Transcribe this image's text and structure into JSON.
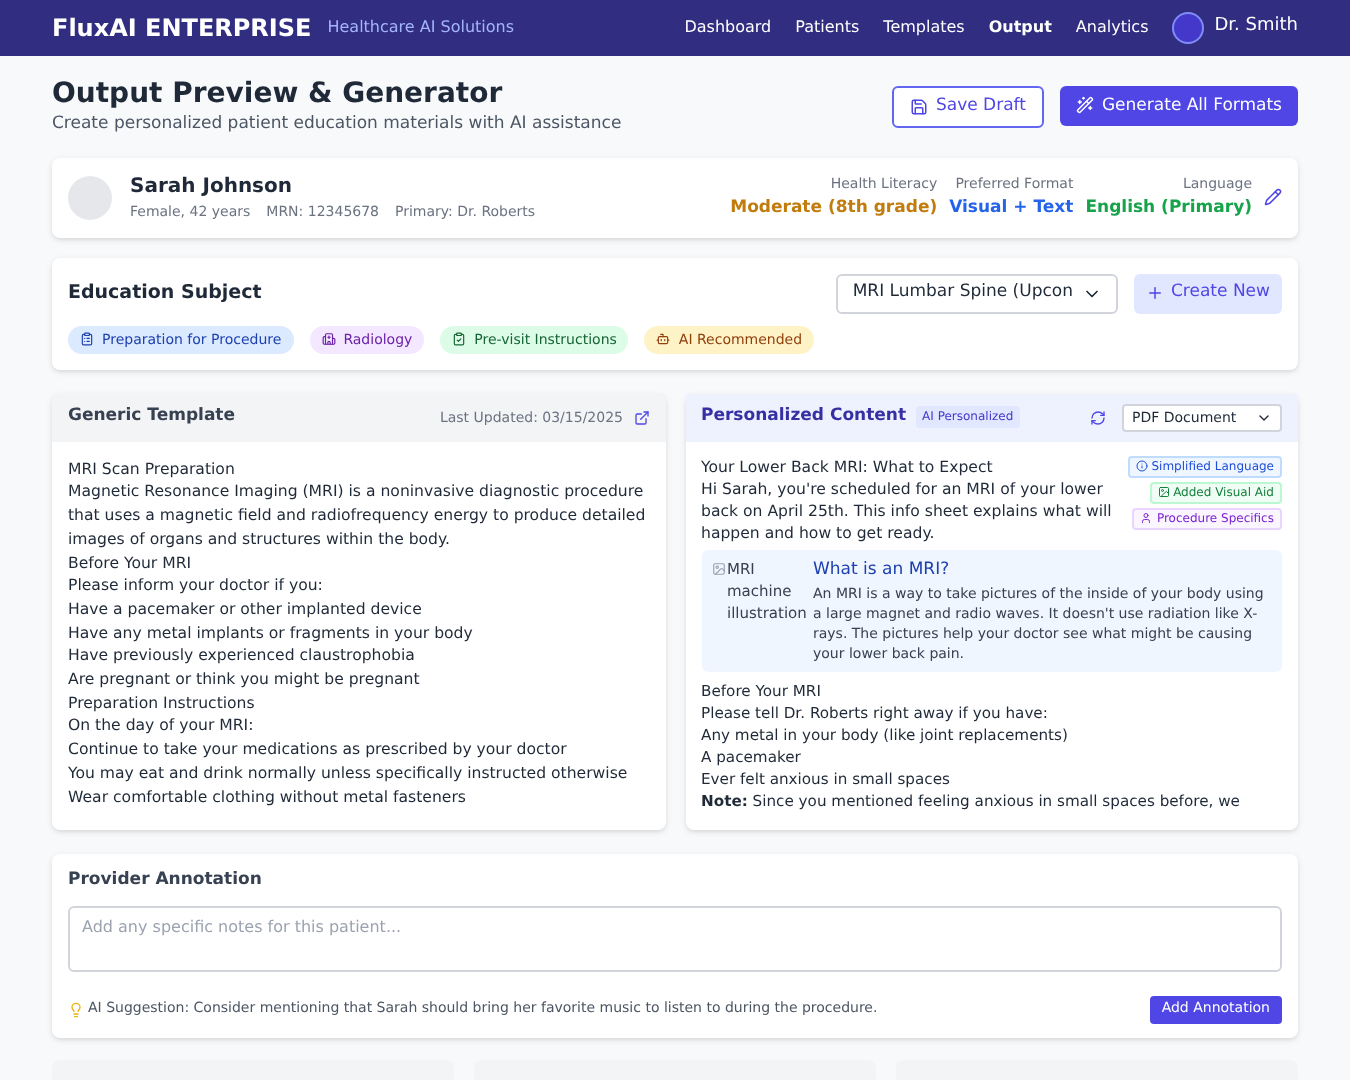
{
  "nav": {
    "brand": "FluxAI ENTERPRISE",
    "tagline": "Healthcare AI Solutions",
    "items": [
      {
        "label": "Dashboard",
        "selected": false
      },
      {
        "label": "Patients",
        "selected": false
      },
      {
        "label": "Templates",
        "selected": false
      },
      {
        "label": "Output",
        "selected": true
      },
      {
        "label": "Analytics",
        "selected": false
      }
    ],
    "user": "Dr. Smith"
  },
  "header": {
    "title": "Output Preview & Generator",
    "subtitle": "Create personalized patient education materials with AI assistance",
    "save_button": "Save Draft",
    "generate_button": "Generate All Formats"
  },
  "patient": {
    "name": "Sarah Johnson",
    "details": [
      "Female, 42 years",
      "MRN: 12345678",
      "Primary: Dr. Roberts"
    ],
    "attributes": [
      {
        "label": "Health Literacy",
        "value": "Moderate (8th grade)",
        "kind": "literacy"
      },
      {
        "label": "Preferred Format",
        "value": "Visual + Text",
        "kind": "format"
      },
      {
        "label": "Language",
        "value": "English (Primary)",
        "kind": "language"
      }
    ]
  },
  "education": {
    "title": "Education Subject",
    "subject": "MRI Lumbar Spine (Upcon",
    "create_button": "Create New",
    "tags": [
      {
        "label": "Preparation for Procedure",
        "kind": "procedure"
      },
      {
        "label": "Radiology",
        "kind": "department"
      },
      {
        "label": "Pre-visit Instructions",
        "kind": "instructions"
      },
      {
        "label": "AI Recommended",
        "kind": "ai"
      }
    ]
  },
  "template": {
    "title": "Generic Template",
    "updated": "Last Updated: 03/15/2025",
    "lines": [
      "MRI Scan Preparation",
      "Magnetic Resonance Imaging (MRI) is a noninvasive diagnostic procedure that uses a magnetic field and radiofrequency energy to produce detailed images of organs and structures within the body.",
      "Before Your MRI",
      "Please inform your doctor if you:",
      "Have a pacemaker or other implanted device",
      "Have any metal implants or fragments in your body",
      "Have previously experienced claustrophobia",
      "Are pregnant or think you might be pregnant",
      "Preparation Instructions",
      "On the day of your MRI:",
      "Continue to take your medications as prescribed by your doctor",
      "You may eat and drink normally unless specifically instructed otherwise",
      "Wear comfortable clothing without metal fasteners"
    ]
  },
  "personalized": {
    "title": "Personalized Content",
    "badge": "AI Personalized",
    "format": "PDF Document",
    "heading": "Your Lower Back MRI: What to Expect",
    "intro": "Hi Sarah, you're scheduled for an MRI of your lower back on April 25th. This info sheet explains what will happen and how to get ready.",
    "changes": [
      {
        "label": "Simplified Language",
        "kind": "language"
      },
      {
        "label": "Added Visual Aid",
        "kind": "visual"
      },
      {
        "label": "Procedure Specifics",
        "kind": "procedure"
      }
    ],
    "callout": {
      "image_alt": "MRI machine illustration",
      "title": "What is an MRI?",
      "text": "An MRI is a way to take pictures of the inside of your body using a large magnet and radio waves. It doesn't use radiation like X-rays. The pictures help your doctor see what might be causing your lower back pain."
    },
    "lines": [
      "Before Your MRI",
      "Please tell Dr. Roberts right away if you have:",
      "Any metal in your body (like joint replacements)",
      "A pacemaker",
      "Ever felt anxious in small spaces",
      "**Note:** Since you mentioned feeling anxious in small spaces before, we"
    ]
  },
  "annotation": {
    "title": "Provider Annotation",
    "placeholder": "Add any specific notes for this patient...",
    "suggestion": "AI Suggestion: Consider mentioning that Sarah should bring her favorite music to listen to during the procedure.",
    "button": "Add Annotation"
  }
}
